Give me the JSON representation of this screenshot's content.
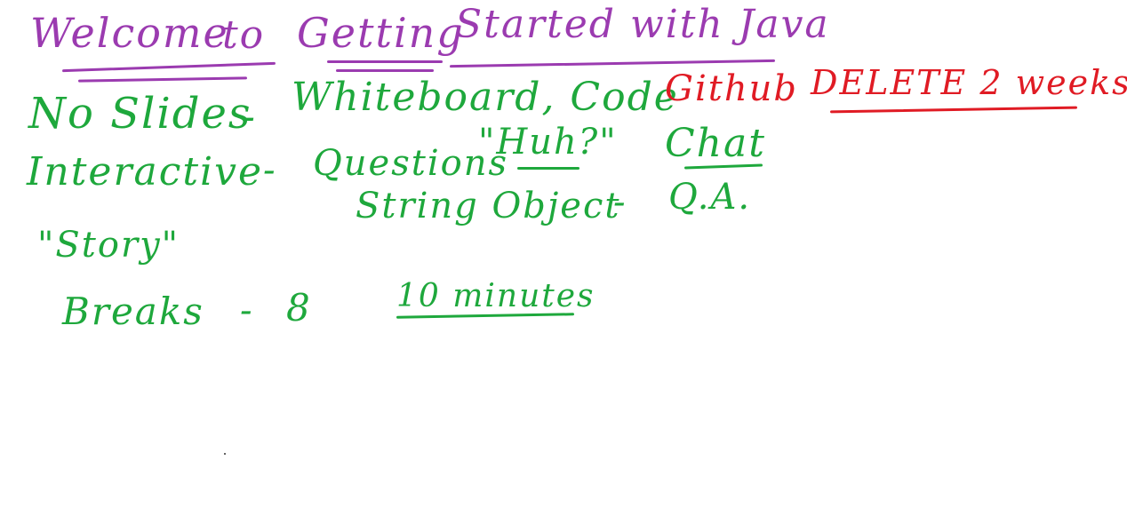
{
  "whiteboard": {
    "title": {
      "welcome": "Welcome",
      "to": "to",
      "getting": "Getting",
      "started_with_java": "Started with Java"
    },
    "lines": {
      "no_slides": "No Slides",
      "dash1": "-",
      "whiteboard_code": "Whiteboard, Code",
      "github": "Github",
      "delete_2_weeks": "DELETE 2 weeks",
      "interactive": "Interactive",
      "dash2": "-",
      "questions": "Questions",
      "huh": "\"Huh?\"",
      "chat": "Chat",
      "string_object": "String Object",
      "dash3": "-",
      "qa": "Q.A.",
      "story": "\"Story\"",
      "breaks": "Breaks",
      "dash4": "-",
      "count": "8",
      "ten_minutes": "10 minutes"
    }
  },
  "colors": {
    "title": "#9b3bb0",
    "body": "#1ea83c",
    "alert": "#e01b24"
  }
}
